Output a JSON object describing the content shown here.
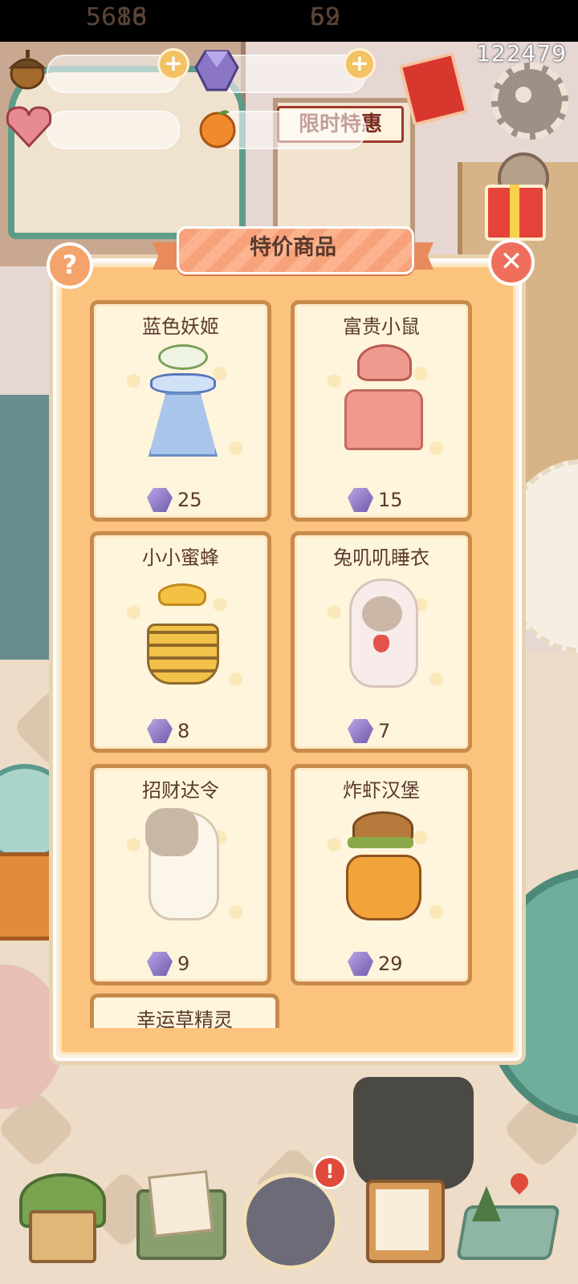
{
  "status": {
    "player_id": "122479"
  },
  "resources": {
    "acorns": {
      "icon": "acorn-icon",
      "value": "5688"
    },
    "gems": {
      "icon": "purple-gem-icon",
      "value": "62"
    },
    "hearts": {
      "icon": "crystal-heart-icon",
      "value": "5616"
    },
    "oranges": {
      "icon": "orange-fruit-icon",
      "value": "59"
    }
  },
  "background": {
    "sale_banner": "限时特惠"
  },
  "dialog": {
    "title": "特价商品",
    "help_symbol": "?",
    "close_symbol": "✕",
    "items": [
      {
        "name": "蓝色妖姬",
        "price": "25",
        "art": "blue-dress-outfit-icon"
      },
      {
        "name": "富贵小鼠",
        "price": "15",
        "art": "pink-dress-beret-outfit-icon"
      },
      {
        "name": "小小蜜蜂",
        "price": "8",
        "art": "bee-outfit-icon"
      },
      {
        "name": "兔叽叽睡衣",
        "price": "7",
        "art": "bunny-pajama-outfit-icon"
      },
      {
        "name": "招财达令",
        "price": "9",
        "art": "lucky-cat-outfit-icon"
      },
      {
        "name": "炸虾汉堡",
        "price": "29",
        "art": "shrimp-burger-outfit-icon"
      },
      {
        "name": "幸运草精灵",
        "price": "",
        "art": ""
      }
    ]
  },
  "nav": {
    "badge": "!",
    "items": [
      {
        "id": "home",
        "icon": "house-icon"
      },
      {
        "id": "mail",
        "icon": "letter-icon"
      },
      {
        "id": "friends",
        "icon": "friends-icon"
      },
      {
        "id": "tasks",
        "icon": "clipboard-icon"
      },
      {
        "id": "map",
        "icon": "map-icon"
      }
    ]
  },
  "colors": {
    "dialog_bg": "#fbc37e",
    "card_border": "#c98b4c",
    "text_brown": "#5a3a2c",
    "close_red": "#ef6e5c"
  }
}
